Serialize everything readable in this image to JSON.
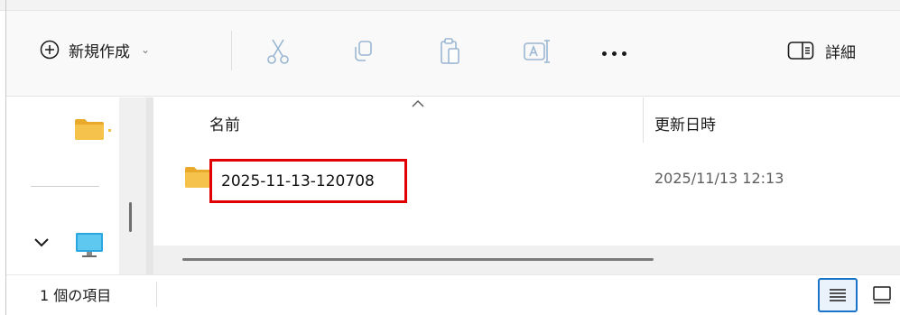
{
  "toolbar": {
    "new_label": "新規作成",
    "new_icon": "plus-circle-icon",
    "cut_icon": "scissors-icon",
    "copy_icon": "copy-icon",
    "paste_icon": "paste-icon",
    "rename_icon": "rename-icon",
    "more_icon": "more-icon",
    "details_label": "詳細",
    "details_icon": "details-pane-icon"
  },
  "columns": {
    "name": "名前",
    "date_modified": "更新日時"
  },
  "files": [
    {
      "name": "2025-11-13-120708",
      "date_modified": "2025/11/13 12:13",
      "icon": "folder-icon"
    }
  ],
  "status": {
    "item_count": "1 個の項目"
  },
  "colors": {
    "folder": "#F5C24C",
    "highlight_border": "#E00000",
    "accent": "#1A73C9"
  }
}
